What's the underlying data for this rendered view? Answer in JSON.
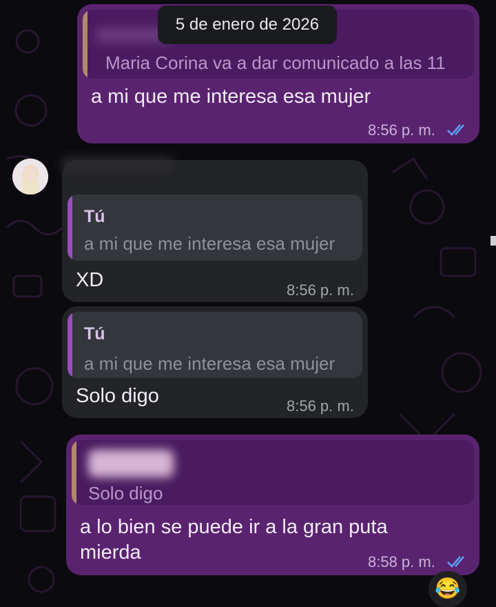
{
  "date_separator": "5 de enero de 2026",
  "colors": {
    "outgoing_bubble": "#5a2370",
    "incoming_bubble": "#222428",
    "read_ticks": "#5aa2f0",
    "background": "#0b0a0f"
  },
  "messages": [
    {
      "direction": "outgoing",
      "quote_sender": "",
      "quote_text": "Maria Corina va a dar comunicado a las 11",
      "text": "a mi que me interesa esa mujer",
      "time": "8:56 p. m.",
      "status_icon": "double-check-read-icon"
    },
    {
      "direction": "incoming",
      "quote_sender": "Tú",
      "quote_text": "a mi que me interesa esa mujer",
      "text": "XD",
      "time": "8:56 p. m."
    },
    {
      "direction": "incoming",
      "quote_sender": "Tú",
      "quote_text": "a mi que me interesa esa mujer",
      "text": "Solo digo",
      "time": "8:56 p. m."
    },
    {
      "direction": "outgoing",
      "quote_sender": "",
      "quote_text": "Solo digo",
      "text": "a lo bien se puede ir a la gran puta mierda",
      "time": "8:58 p. m.",
      "status_icon": "double-check-read-icon"
    }
  ],
  "reaction": "😂"
}
